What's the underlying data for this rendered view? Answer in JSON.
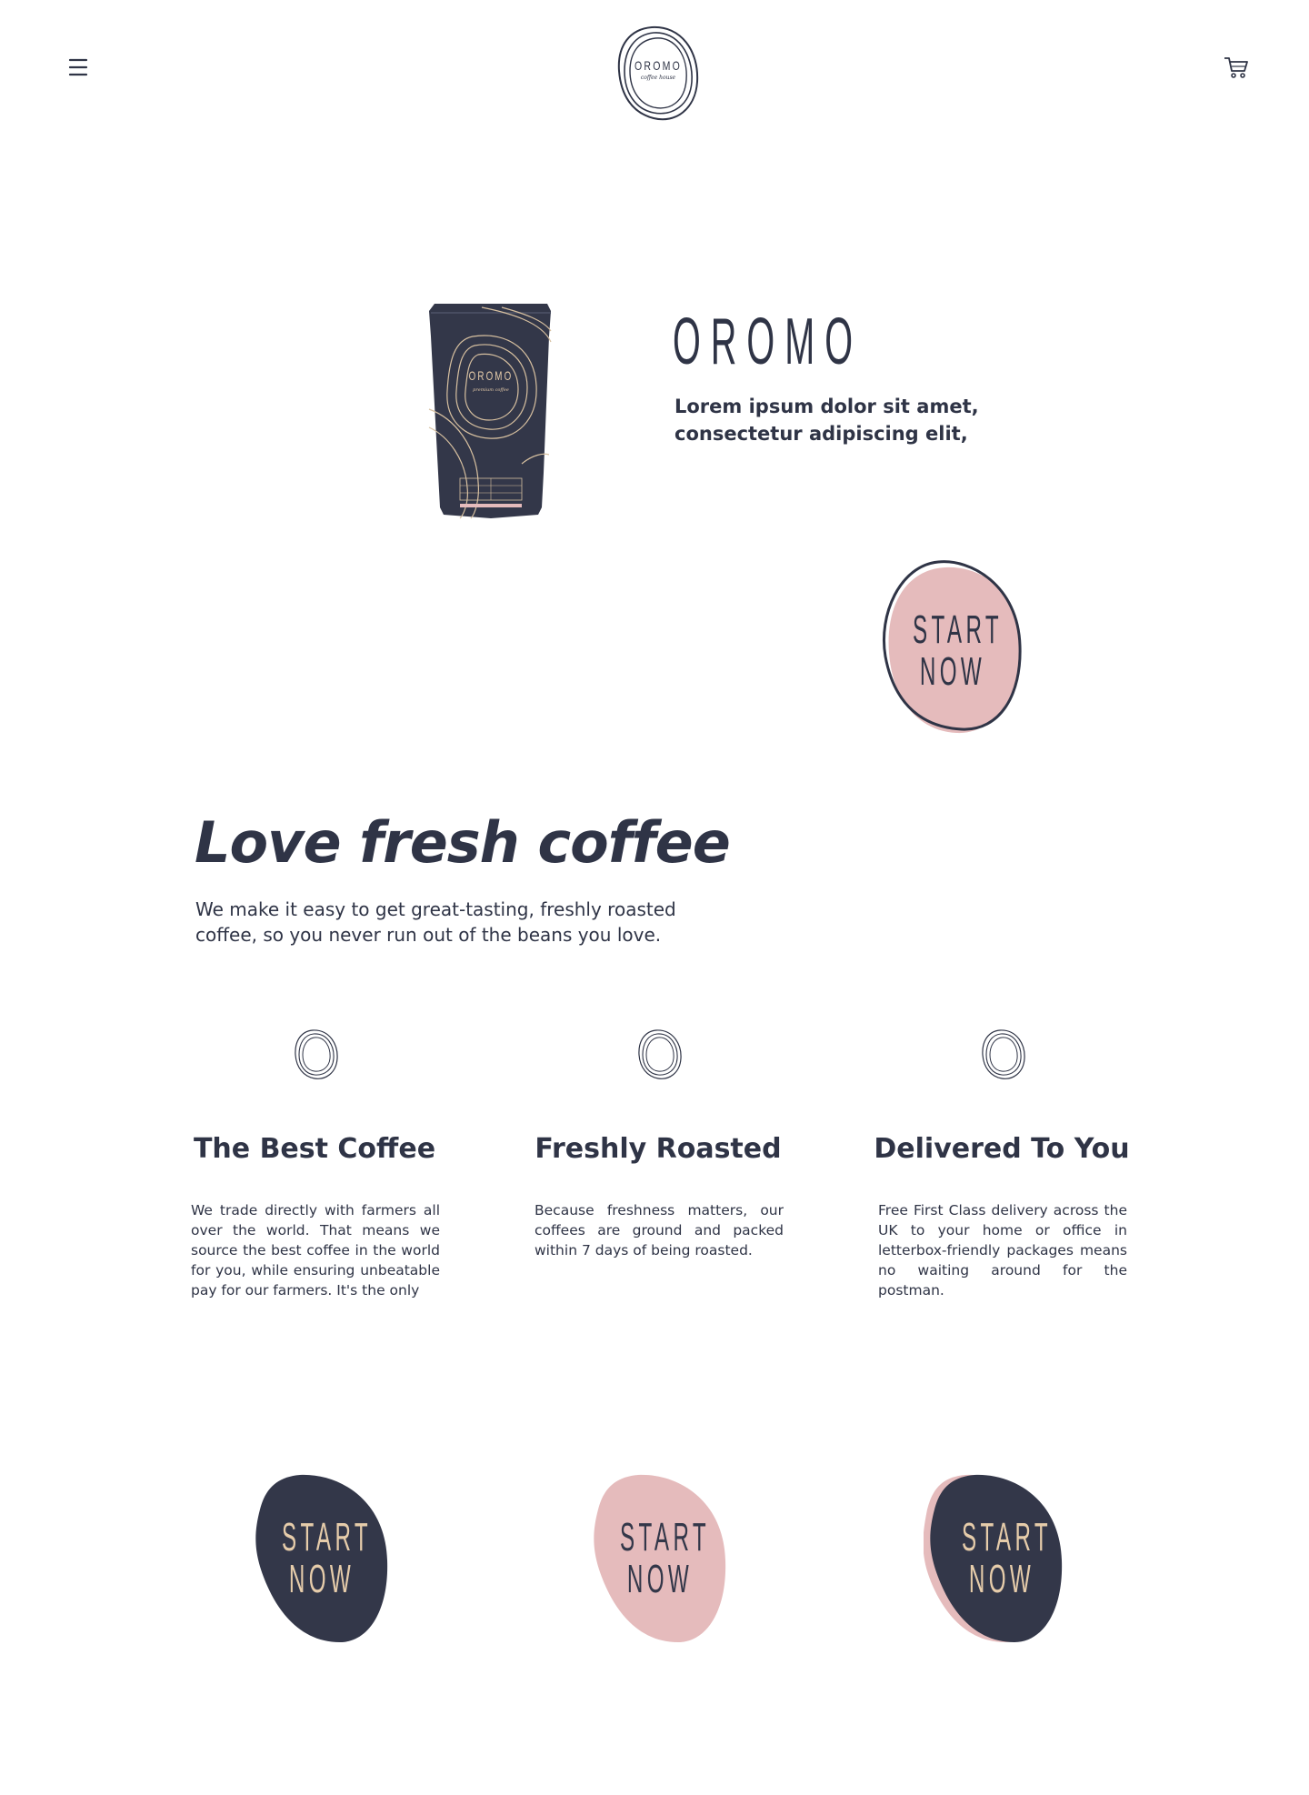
{
  "header": {
    "menu_icon": "hamburger-menu-icon",
    "cart_icon": "shopping-cart-icon",
    "logo_text": "OROMO",
    "logo_sub": "coffee house"
  },
  "hero": {
    "product_image": "coffee-bag",
    "bag_brand": "OROMO",
    "bag_sub": "premium coffee",
    "brand": "OROMO",
    "description_line1": "Lorem ipsum dolor sit amet,",
    "description_line2": "consectetur adipiscing elit,",
    "start_line1": "START",
    "start_line2": "NOW"
  },
  "intro": {
    "title": "Love fresh coffee",
    "text_line1": "We make it easy to get great-tasting, freshly roasted",
    "text_line2": "coffee, so you never run out of the beans you love."
  },
  "features": [
    {
      "icon": "ring-logo-icon",
      "title": "The Best Coffee",
      "text": "We trade directly with farmers all over the world. That means we source the best coffee in the world for you, while ensuring unbeatable pay for our farmers. It's the only"
    },
    {
      "icon": "ring-logo-icon",
      "title": "Freshly Roasted",
      "text": "Because freshness matters, our coffees are ground and packed within 7 days of being roasted."
    },
    {
      "icon": "ring-logo-icon",
      "title": "Delivered To You",
      "text": "Free First Class delivery across the UK to your home or office in letterbox-friendly packages means no waiting around for the postman."
    }
  ],
  "ctas": [
    {
      "line1": "START",
      "line2": "NOW",
      "fill": "#333749",
      "text_color": "#e6ccaa"
    },
    {
      "line1": "START",
      "line2": "NOW",
      "fill": "#e5bbbc",
      "text_color": "#333749"
    },
    {
      "line1": "START",
      "line2": "NOW",
      "fill": "#333749",
      "text_color": "#e6ccaa",
      "shadow": "#e5bbbc"
    }
  ],
  "colors": {
    "navy": "#2f3446",
    "pink": "#e5bbbc",
    "gold": "#e6ccaa"
  }
}
